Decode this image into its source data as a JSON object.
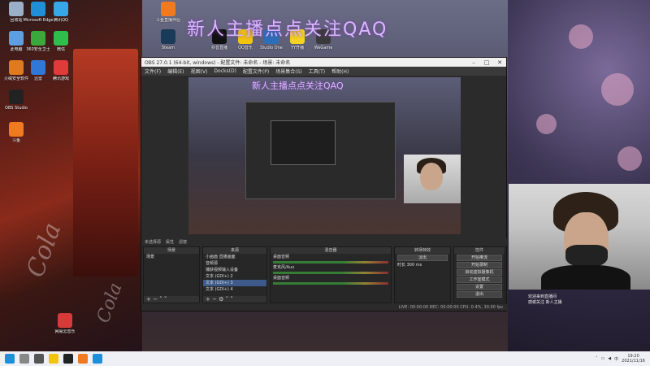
{
  "overlay": {
    "title": "新人主播点点关注QAQ"
  },
  "desktop_icons": [
    {
      "label": "回收站",
      "color": "#9bb0c8"
    },
    {
      "label": "Microsoft Edge",
      "color": "#1f8fd8"
    },
    {
      "label": "腾讯QQ",
      "color": "#38a7e8"
    },
    {
      "label": "此电脑",
      "color": "#5d9fe0"
    },
    {
      "label": "360安全卫士",
      "color": "#3aa83a"
    },
    {
      "label": "微信",
      "color": "#2dbe4b"
    },
    {
      "label": "火绒安全软件",
      "color": "#e07a1f"
    },
    {
      "label": "迅雷",
      "color": "#2f78d8"
    },
    {
      "label": "腾讯游戏",
      "color": "#e03a3a"
    },
    {
      "label": "斗鱼直播伴侣",
      "color": "#f07a1f"
    },
    {
      "label": "Steam",
      "color": "#1a3a5a"
    },
    {
      "label": "抖音直播",
      "color": "#111111"
    },
    {
      "label": "QQ音乐",
      "color": "#f1c40f"
    },
    {
      "label": "Studio One",
      "color": "#2a6fb8"
    },
    {
      "label": "YY开播",
      "color": "#f5d31f"
    },
    {
      "label": "WeGame",
      "color": "#3a3a3a"
    },
    {
      "label": "OBS Studio",
      "color": "#222222"
    },
    {
      "label": "斗鱼",
      "color": "#f07a1f"
    },
    {
      "label": "网易云音乐",
      "color": "#d83a3a"
    }
  ],
  "obs": {
    "title": "OBS 27.0.1 (64-bit, windows) - 配置文件: 未命名 - 场景: 未命名",
    "menu": [
      "文件(F)",
      "编辑(E)",
      "视图(V)",
      "Docks(D)",
      "配置文件(P)",
      "场景集合(S)",
      "工具(T)",
      "帮助(H)"
    ],
    "preview_title": "新人主播点点关注QAQ",
    "status_row": [
      "未选择源",
      "属性",
      "滤镜"
    ],
    "scenes": {
      "header": "场景",
      "items": [
        "场景"
      ]
    },
    "sources": {
      "header": "来源",
      "items": [
        "小画面 直播画面",
        "音频源",
        "捕获视频输入设备",
        "文本 (GDI+) 2",
        "文本 (GDI+) 3",
        "文本 (GDI+) 4"
      ]
    },
    "mixer": {
      "header": "混音器",
      "channels": [
        "桌面音频",
        "麦克风/Aux",
        "桌面音频"
      ]
    },
    "transitions": {
      "header": "转场特效",
      "type": "淡出",
      "duration_label": "时长",
      "duration": "300 ms"
    },
    "controls": {
      "header": "控件",
      "buttons": [
        "开始推流",
        "开始录制",
        "启动虚拟摄像机",
        "工作室模式",
        "设置",
        "退出"
      ]
    },
    "footer": "LIVE: 00:00:00   REC: 00:00:00   CPU: 0.4%, 30.00 fps"
  },
  "chat": [
    "欢迎来到直播间",
    "感谢关注 新人主播"
  ],
  "taskbar": {
    "time": "19:20",
    "date": "2021/11/16",
    "lang": "中"
  }
}
